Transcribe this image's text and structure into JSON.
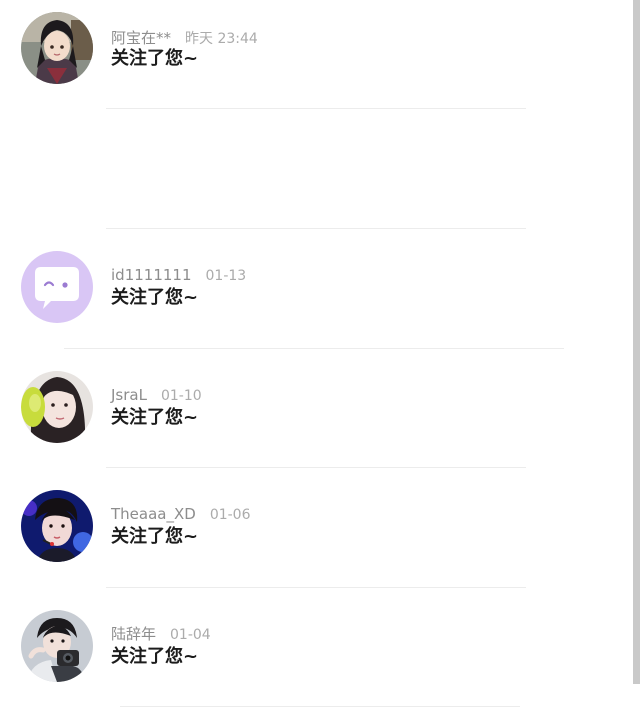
{
  "notifications": [
    {
      "name": "阿宝在**",
      "time": "昨天 23:44",
      "message": "关注了您~",
      "avatar_icon": "anime-character-avatar"
    },
    {
      "name": "id1111111",
      "time": "01-13",
      "message": "关注了您~",
      "avatar_icon": "default-chat-bubble-avatar"
    },
    {
      "name": "JsraL",
      "time": "01-10",
      "message": "关注了您~",
      "avatar_icon": "girl-photo-avatar"
    },
    {
      "name": "Theaaa_XD",
      "time": "01-06",
      "message": "关注了您~",
      "avatar_icon": "stage-performer-avatar"
    },
    {
      "name": "陆辞年",
      "time": "01-04",
      "message": "关注了您~",
      "avatar_icon": "boy-with-camera-avatar"
    }
  ],
  "colors": {
    "default_avatar_bg": "#d9c6f5",
    "name_text": "#8d8d8d",
    "time_text": "#ababab",
    "message_text": "#1c1c1c",
    "divider": "#ececec"
  }
}
